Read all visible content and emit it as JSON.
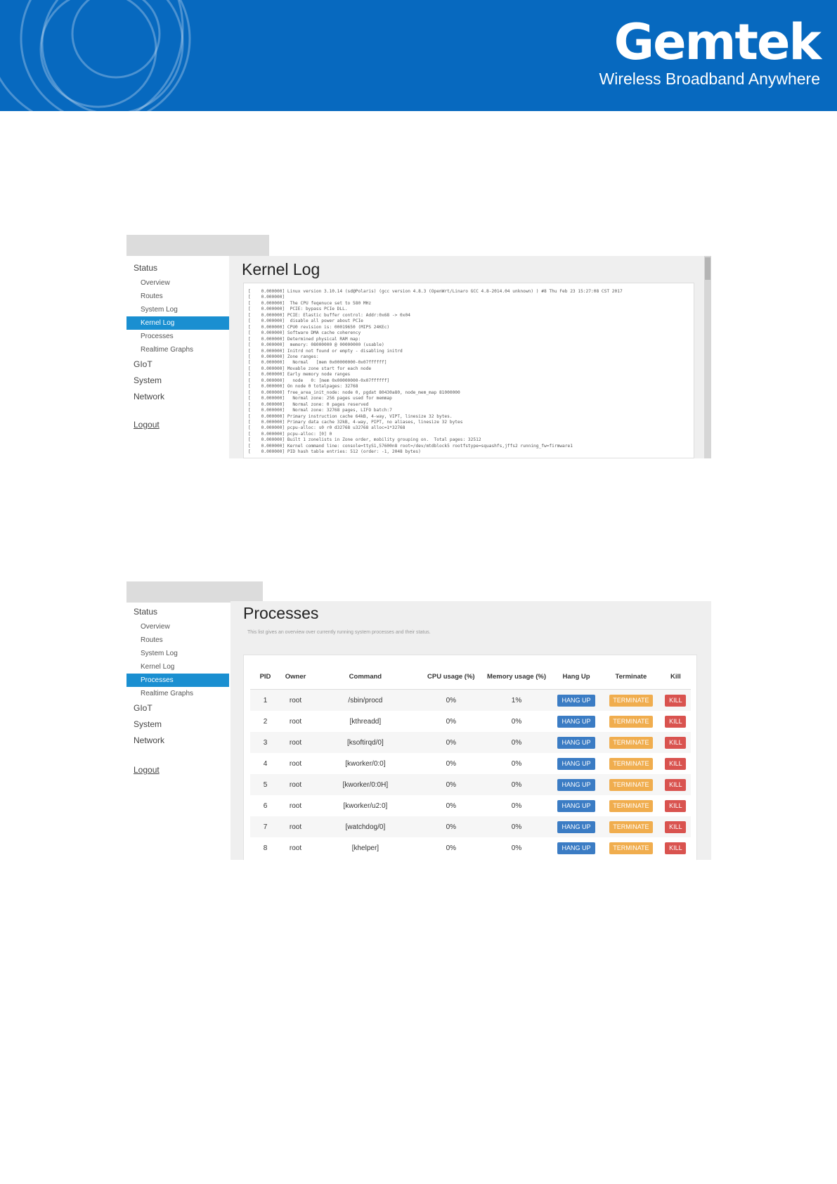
{
  "header": {
    "brand_name": "Gemtek",
    "tagline": "Wireless Broadband Anywhere",
    "background_color": "#0769bf"
  },
  "kernel_panel": {
    "title": "Kernel Log",
    "sidebar": {
      "groups": [
        "Status",
        "GIoT",
        "System",
        "Network"
      ],
      "status_items": [
        "Overview",
        "Routes",
        "System Log",
        "Kernel Log",
        "Processes",
        "Realtime Graphs"
      ],
      "active_item": "Kernel Log",
      "logout": "Logout"
    },
    "log_lines": [
      "[    0.000000] Linux version 3.10.14 (sd@Polaris) (gcc version 4.8.3 (OpenWrt/Linaro GCC 4.8-2014.04 unknown) ) #8 Thu Feb 23 15:27:08 CST 2017",
      "[    0.000000]",
      "[    0.000000]  The CPU feqenuce set to 580 MHz",
      "[    0.000000]  PCIE: bypass PCIe DLL.",
      "[    0.000000] PCIE: Elastic buffer control: Addr:0x68 -> 0x04",
      "[    0.000000]  disable all power about PCIe",
      "[    0.000000] CPU0 revision is: 00019650 (MIPS 24KEc)",
      "[    0.000000] Software DMA cache coherency",
      "[    0.000000] Determined physical RAM map:",
      "[    0.000000]  memory: 08000000 @ 00000000 (usable)",
      "[    0.000000] Initrd not found or empty - disabling initrd",
      "[    0.000000] Zone ranges:",
      "[    0.000000]   Normal   [mem 0x00000000-0x07ffffff]",
      "[    0.000000] Movable zone start for each node",
      "[    0.000000] Early memory node ranges",
      "[    0.000000]   node   0: [mem 0x00000000-0x07ffffff]",
      "[    0.000000] On node 0 totalpages: 32768",
      "[    0.000000] free_area_init_node: node 0, pgdat 80430a80, node_mem_map 81000000",
      "[    0.000000]   Normal zone: 256 pages used for memmap",
      "[    0.000000]   Normal zone: 0 pages reserved",
      "[    0.000000]   Normal zone: 32768 pages, LIFO batch:7",
      "[    0.000000] Primary instruction cache 64kB, 4-way, VIPT, linesize 32 bytes.",
      "[    0.000000] Primary data cache 32kB, 4-way, PIPT, no aliases, linesize 32 bytes",
      "[    0.000000] pcpu-alloc: s0 r0 d32768 u32768 alloc=1*32768",
      "[    0.000000] pcpu-alloc: [0] 0",
      "[    0.000000] Built 1 zonelists in Zone order, mobility grouping on.  Total pages: 32512",
      "[    0.000000] Kernel command line: console=ttyS1,57600n8 root=/dev/mtdblock5 rootfstype=squashfs,jffs2 running_fw=firmware1",
      "[    0.000000] PID hash table entries: 512 (order: -1, 2048 bytes)"
    ]
  },
  "process_panel": {
    "title": "Processes",
    "description": "This list gives an overview over currently running system processes and their status.",
    "sidebar": {
      "groups": [
        "Status",
        "GIoT",
        "System",
        "Network"
      ],
      "status_items": [
        "Overview",
        "Routes",
        "System Log",
        "Kernel Log",
        "Processes",
        "Realtime Graphs"
      ],
      "active_item": "Processes",
      "logout": "Logout"
    },
    "columns": [
      "PID",
      "Owner",
      "Command",
      "CPU usage (%)",
      "Memory usage (%)",
      "Hang Up",
      "Terminate",
      "Kill"
    ],
    "buttons": {
      "hang": "HANG UP",
      "term": "TERMINATE",
      "kill": "KILL"
    },
    "rows": [
      [
        "1",
        "root",
        "/sbin/procd",
        "0%",
        "1%"
      ],
      [
        "2",
        "root",
        "[kthreadd]",
        "0%",
        "0%"
      ],
      [
        "3",
        "root",
        "[ksoftirqd/0]",
        "0%",
        "0%"
      ],
      [
        "4",
        "root",
        "[kworker/0:0]",
        "0%",
        "0%"
      ],
      [
        "5",
        "root",
        "[kworker/0:0H]",
        "0%",
        "0%"
      ],
      [
        "6",
        "root",
        "[kworker/u2:0]",
        "0%",
        "0%"
      ],
      [
        "7",
        "root",
        "[watchdog/0]",
        "0%",
        "0%"
      ],
      [
        "8",
        "root",
        "[khelper]",
        "0%",
        "0%"
      ]
    ]
  }
}
